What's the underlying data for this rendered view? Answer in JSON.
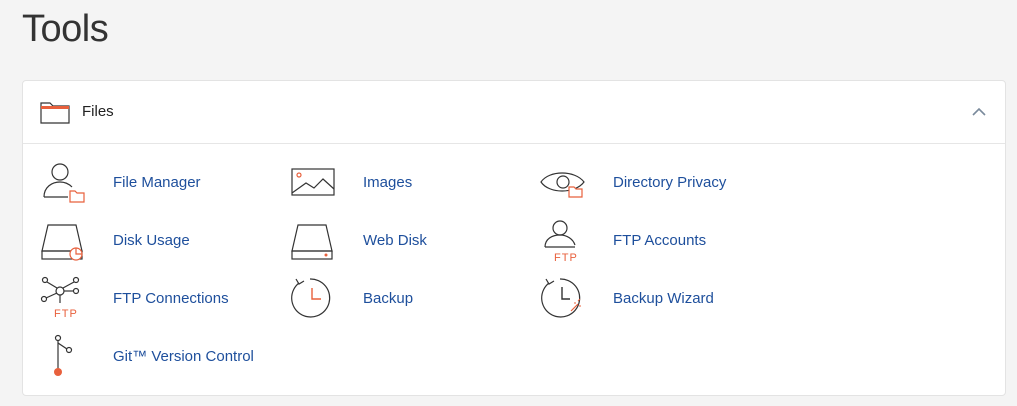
{
  "page": {
    "title": "Tools"
  },
  "section": {
    "title": "Files",
    "icon": "folder-icon",
    "toggle_icon": "chevron-up-icon",
    "items": [
      {
        "label": "File Manager",
        "icon": "user-folder-icon"
      },
      {
        "label": "Images",
        "icon": "image-icon"
      },
      {
        "label": "Directory Privacy",
        "icon": "eye-folder-icon"
      },
      {
        "label": "Disk Usage",
        "icon": "disk-pie-icon"
      },
      {
        "label": "Web Disk",
        "icon": "disk-drive-icon"
      },
      {
        "label": "FTP Accounts",
        "icon": "ftp-user-icon"
      },
      {
        "label": "FTP Connections",
        "icon": "ftp-network-icon"
      },
      {
        "label": "Backup",
        "icon": "backup-clock-icon"
      },
      {
        "label": "Backup Wizard",
        "icon": "backup-wizard-icon"
      },
      {
        "label": "Git™ Version Control",
        "icon": "git-branch-icon"
      }
    ],
    "ftp_tag": "FTP"
  },
  "colors": {
    "link": "#1e4f9c",
    "accent": "#e8603c",
    "icon_stroke": "#333333",
    "background": "#f4f4f4"
  }
}
